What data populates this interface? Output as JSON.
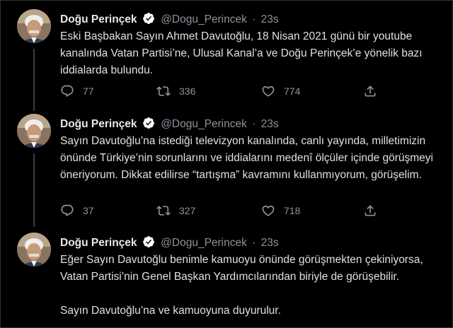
{
  "account": {
    "name": "Doğu Perinçek",
    "handle": "@Dogu_Perincek",
    "separator": "·",
    "verified": true
  },
  "colors": {
    "background": "#000000",
    "text": "#e0e0e0",
    "muted": "#8b949e",
    "verified_badge": "#ffffff",
    "thread_line": "#3a3f44"
  },
  "tweets": [
    {
      "time": "23s",
      "text": "Eski Başbakan Sayın Ahmet Davutoğlu, 18 Nisan 2021 günü bir youtube kanalında Vatan Partisi’ne, Ulusal Kanal’a ve Doğu Perinçek’e yönelik bazı iddialarda bulundu.",
      "replies": "77",
      "retweets": "336",
      "likes": "774"
    },
    {
      "time": "23s",
      "text": "Sayın Davutoğlu’na istediği televizyon kanalında, canlı yayında, milletimizin önünde Türkiye’nin sorunlarını ve iddialarını medenî ölçüler içinde görüşmeyi öneriyorum. Dikkat edilirse “tartışma” kavramını kullanmıyorum, görüşelim.",
      "replies": "37",
      "retweets": "327",
      "likes": "718"
    },
    {
      "time": "23s",
      "text": "Eğer Sayın Davutoğlu benimle kamuoyu önünde görüşmekten çekiniyorsa, Vatan Partisi’nin Genel Başkan Yardımcılarından biriyle de görüşebilir.\n\nSayın Davutoğlu’na ve kamuoyuna duyurulur."
    }
  ],
  "icons": {
    "reply": "reply-icon",
    "retweet": "retweet-icon",
    "like": "heart-icon",
    "share": "share-icon",
    "verified": "verified-badge-icon"
  }
}
